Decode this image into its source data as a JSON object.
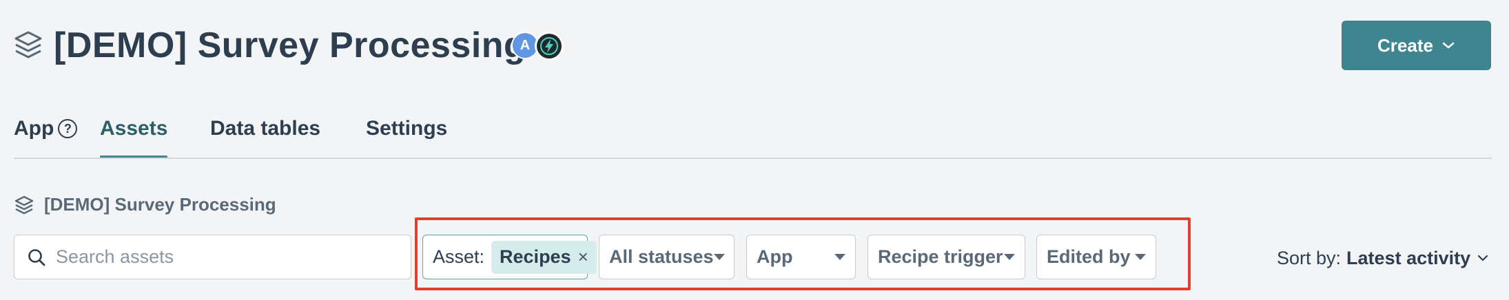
{
  "header": {
    "title": "[DEMO] Survey Processing",
    "avatar_initial": "A",
    "create_label": "Create"
  },
  "tabs": [
    {
      "label": "App",
      "active": false,
      "has_help": true,
      "help_glyph": "?"
    },
    {
      "label": "Assets",
      "active": true
    },
    {
      "label": "Data tables",
      "active": false
    },
    {
      "label": "Settings",
      "active": false
    }
  ],
  "breadcrumb": {
    "label": "[DEMO] Survey Processing"
  },
  "search": {
    "placeholder": "Search assets",
    "value": ""
  },
  "filters": {
    "asset": {
      "prefix": "Asset:",
      "tag": "Recipes",
      "remove_glyph": "×"
    },
    "status": {
      "label": "All statuses"
    },
    "app": {
      "label": "App"
    },
    "trigger": {
      "label": "Recipe trigger"
    },
    "edited_by": {
      "label": "Edited by"
    }
  },
  "sort": {
    "prefix": "Sort by:",
    "value": "Latest activity"
  },
  "colors": {
    "accent": "#3f8590",
    "highlight_border": "#e0412e",
    "avatar": "#6196e4",
    "tag_bg": "#d5ecea"
  },
  "icons": [
    "stack-icon",
    "lightning-icon",
    "chevron-down-icon",
    "help-icon",
    "search-icon",
    "caret-down-icon",
    "close-icon"
  ]
}
